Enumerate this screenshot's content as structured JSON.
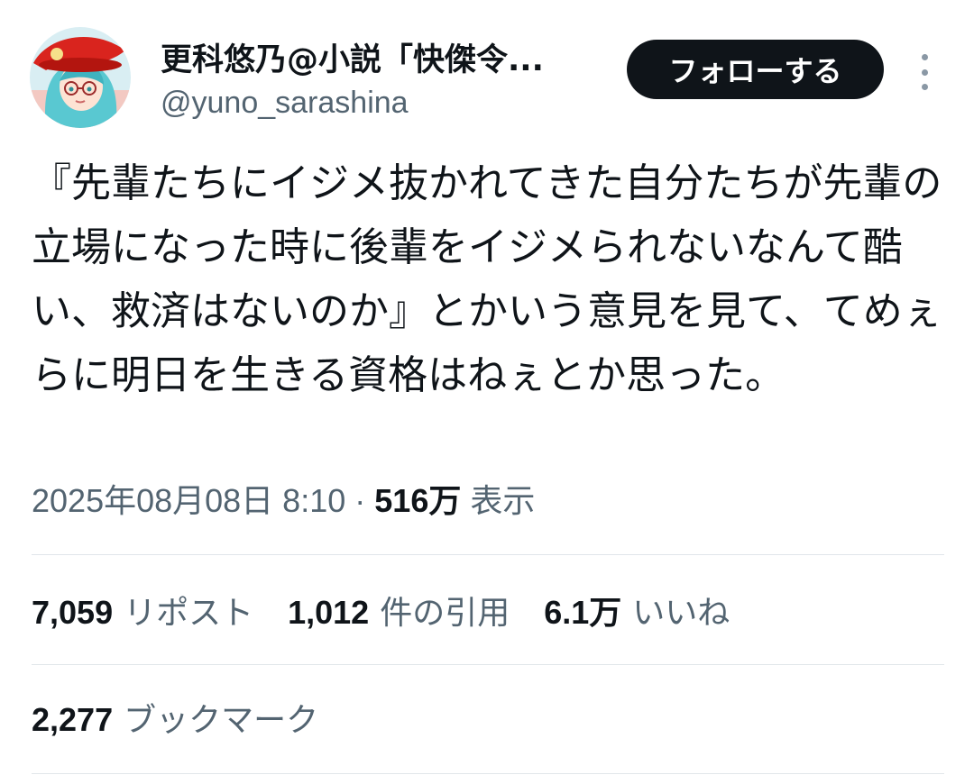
{
  "author": {
    "display_name": "更科悠乃@小説「快傑令...",
    "handle": "@yuno_sarashina",
    "avatar_icon": "user-avatar"
  },
  "follow_button": {
    "label": "フォローする"
  },
  "more_menu": {
    "icon": "more-vertical-icon"
  },
  "tweet": {
    "text": "『先輩たちにイジメ抜かれてきた自分たちが先輩の立場になった時に後輩をイジメられないなんて酷い、救済はないのか』とかいう意見を見て、てめぇらに明日を生きる資格はねぇとか思った。"
  },
  "meta": {
    "timestamp": "2025年08月08日 8:10",
    "separator": "·",
    "views_count": "516万",
    "views_label": "表示"
  },
  "stats": {
    "reposts": {
      "count": "7,059",
      "label": "リポスト"
    },
    "quotes": {
      "count": "1,012",
      "label": "件の引用"
    },
    "likes": {
      "count": "6.1万",
      "label": "いいね"
    },
    "bookmarks": {
      "count": "2,277",
      "label": "ブックマーク"
    }
  },
  "colors": {
    "text_primary": "#0f1419",
    "text_secondary": "#536471",
    "button_bg": "#0f1419",
    "divider": "#e1e6ea"
  }
}
